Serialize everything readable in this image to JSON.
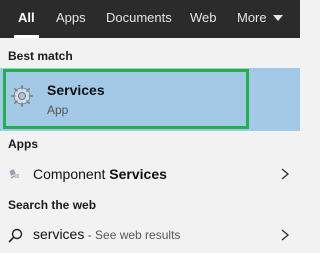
{
  "tabs": [
    {
      "label": "All"
    },
    {
      "label": "Apps"
    },
    {
      "label": "Documents"
    },
    {
      "label": "Web"
    },
    {
      "label": "More"
    }
  ],
  "sections": {
    "best_match": "Best match",
    "apps": "Apps",
    "web": "Search the web"
  },
  "best_match": {
    "title": "Services",
    "subtitle": "App",
    "icon": "gear-icon"
  },
  "apps": [
    {
      "prefix": "Component ",
      "bold": "Services",
      "icon": "component-services-icon"
    }
  ],
  "web": {
    "query": "services",
    "hint": " - See web results",
    "icon": "search-icon"
  },
  "colors": {
    "topbar": "#2b2b2b",
    "selection": "#a4c9e6",
    "highlight_border": "#21b14a",
    "panel": "#f2f2f2"
  }
}
